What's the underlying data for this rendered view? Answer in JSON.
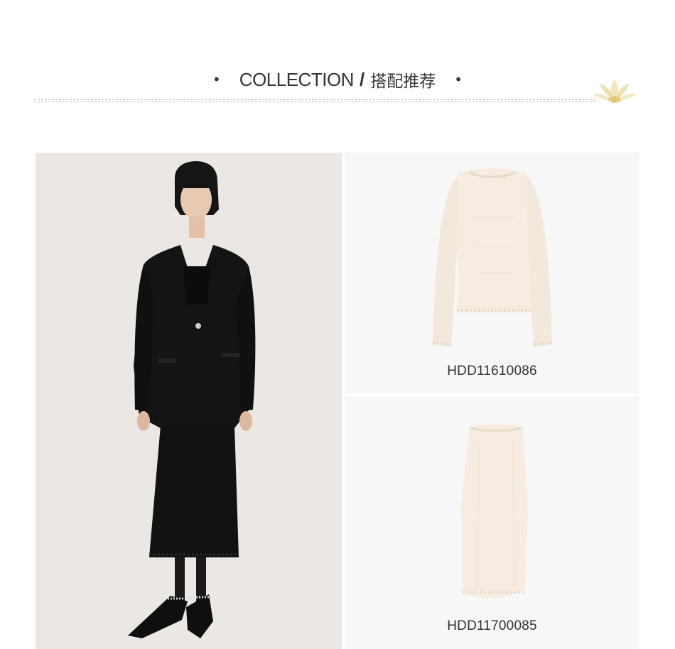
{
  "header": {
    "dot_left": "•",
    "title_en": "COLLECTION",
    "separator": "/",
    "title_cn": "搭配推荐",
    "dot_right": "•"
  },
  "outfit": {
    "model_photo": "woman-in-black-blazer-and-black-knit-midi-dress",
    "products": [
      {
        "code": "HDD11610086",
        "image": "cream-long-sleeve-knit-top",
        "icon": "sweater-icon"
      },
      {
        "code": "HDD11700085",
        "image": "cream-knit-midi-skirt",
        "icon": "skirt-icon"
      }
    ]
  },
  "colors": {
    "page_bg": "#ffffff",
    "card_bg": "#f7f7f7",
    "photo_bg": "#ebe8e3",
    "text": "#333333",
    "cream": "#f6ece1",
    "black_garment": "#141414"
  }
}
